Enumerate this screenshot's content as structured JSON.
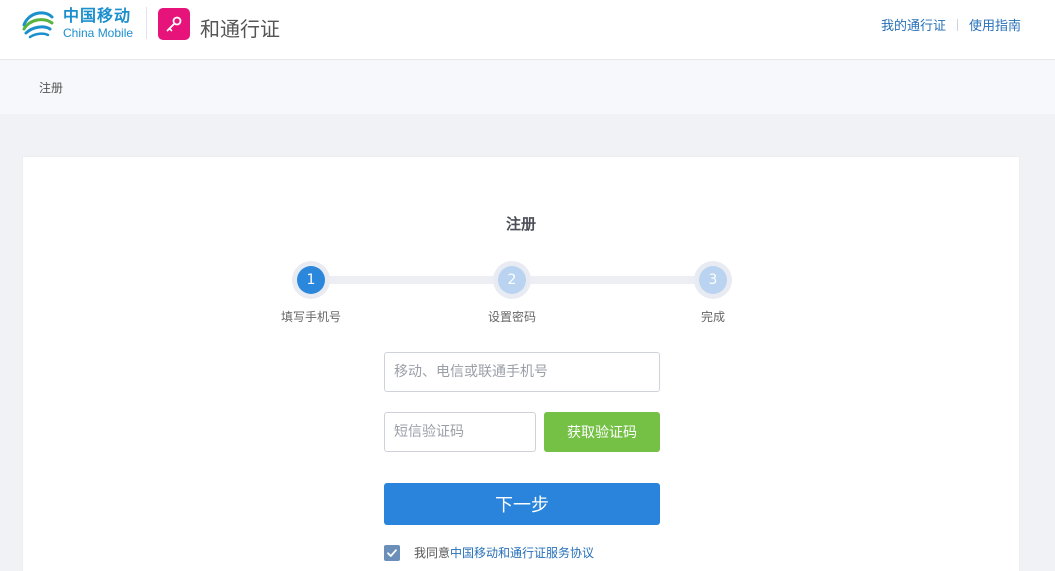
{
  "header": {
    "logo_cn": "中国移动",
    "logo_en": "China Mobile",
    "app_title": "和通行证",
    "links": [
      "我的通行证",
      "使用指南"
    ]
  },
  "breadcrumb": "注册",
  "card": {
    "title": "注册",
    "steps": [
      {
        "number": "1",
        "label": "填写手机号",
        "state": "active"
      },
      {
        "number": "2",
        "label": "设置密码",
        "state": "pending"
      },
      {
        "number": "3",
        "label": "完成",
        "state": "pending"
      }
    ],
    "phone_placeholder": "移动、电信或联通手机号",
    "sms_placeholder": "短信验证码",
    "sms_button": "获取验证码",
    "next_button": "下一步",
    "agree_prefix": "我同意",
    "agree_link": "中国移动和通行证服务协议"
  },
  "colors": {
    "brand_blue": "#1c8fcd",
    "app_icon": "#e6147a",
    "primary": "#2a84dc",
    "success": "#74c146"
  },
  "icons": {
    "logo": "china-mobile-logo-icon",
    "app": "key-icon",
    "check": "checkmark-icon"
  }
}
